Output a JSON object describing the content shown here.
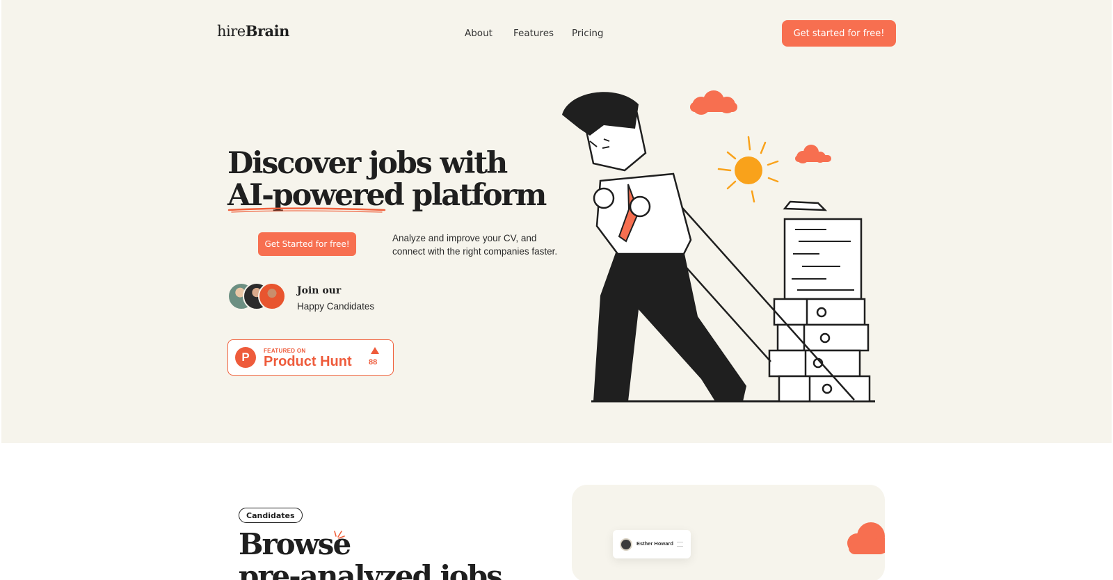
{
  "header": {
    "logo_light": "hire",
    "logo_bold": "Brain",
    "nav": [
      {
        "label": "About"
      },
      {
        "label": "Features"
      },
      {
        "label": "Pricing"
      }
    ],
    "cta_label": "Get started for free!"
  },
  "hero": {
    "headline_line1": "Discover jobs with",
    "headline_line2_underlined": "AI-powered",
    "headline_line2_rest": " platform",
    "cta_label": "Get Started for free!",
    "description": "Analyze and improve your CV, and connect with the right companies faster.",
    "join_title": "Join our",
    "join_subtitle": "Happy Candidates",
    "product_hunt": {
      "featured_label": "FEATURED ON",
      "name": "Product Hunt",
      "count": "88"
    }
  },
  "section": {
    "pill_label": "Candidates",
    "title_line1": "Browse",
    "title_line2": "pre-analyzed jobs",
    "card_name": "Esther Howard"
  },
  "colors": {
    "accent": "#f76f50",
    "hero_bg": "#f6f4ec",
    "sun": "#f9a21b",
    "ink": "#1f1f1f"
  }
}
